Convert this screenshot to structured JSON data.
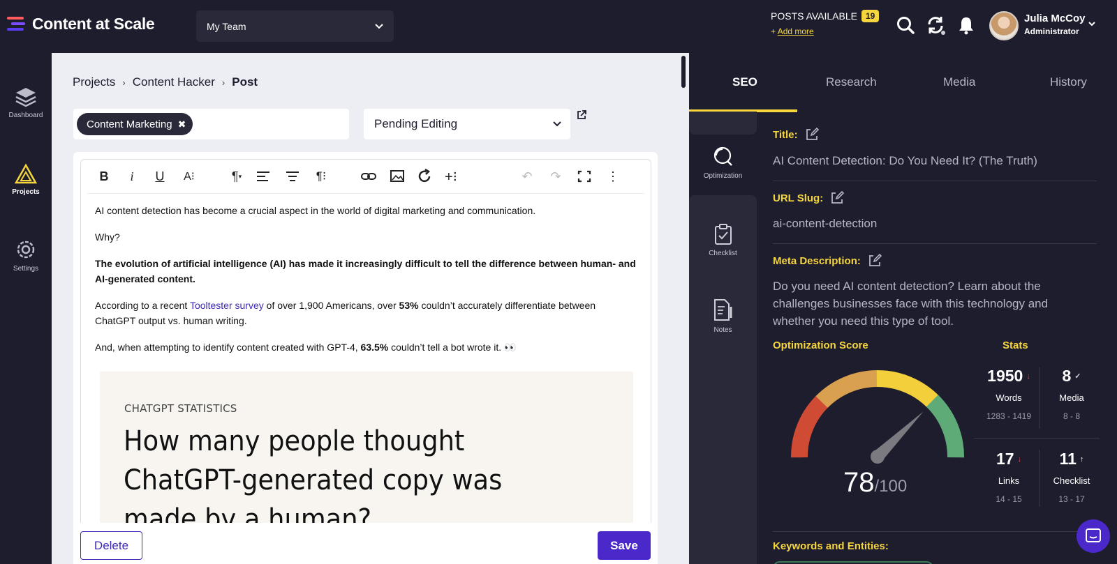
{
  "header": {
    "app_name": "Content at Scale",
    "team": "My Team",
    "posts_label": "POSTS AVAILABLE",
    "posts_count": "19",
    "add_more": "Add more",
    "user_name": "Julia McCoy",
    "user_role": "Administrator"
  },
  "sidebar": {
    "items": [
      {
        "label": "Dashboard",
        "icon": "layers-icon"
      },
      {
        "label": "Projects",
        "icon": "triangle-icon"
      },
      {
        "label": "Settings",
        "icon": "gear-icon"
      }
    ]
  },
  "breadcrumb": [
    "Projects",
    "Content Hacker",
    "Post"
  ],
  "tag": "Content Marketing",
  "status": "Pending Editing",
  "editor": {
    "p1": "AI content detection has become a crucial aspect in the world of digital marketing and communication.",
    "p2": "Why?",
    "p3": "The evolution of artificial intelligence (AI) has made it increasingly difficult to tell the difference between human- and AI-generated content.",
    "p4_a": "According to a recent ",
    "p4_link": "Tooltester survey",
    "p4_b": " of over 1,900 Americans, over ",
    "p4_bold": "53%",
    "p4_c": " couldn’t accurately differentiate between ChatGPT output vs. human writing.",
    "p5_a": "And, when attempting to identify content created with GPT-4, ",
    "p5_bold": "63.5%",
    "p5_c": " couldn’t tell a bot wrote it. 👀",
    "image_kicker": "CHATGPT STATISTICS",
    "image_headline": "How many people thought ChatGPT-generated copy was made by a human?"
  },
  "actions": {
    "delete": "Delete",
    "save": "Save"
  },
  "right_panel": {
    "tabs": [
      "SEO",
      "Research",
      "Media",
      "History"
    ],
    "rail": [
      "Optimization",
      "Checklist",
      "Notes"
    ],
    "title_label": "Title:",
    "title_value": "AI Content Detection: Do You Need It? (The Truth)",
    "slug_label": "URL Slug:",
    "slug_value": "ai-content-detection",
    "meta_label": "Meta Description:",
    "meta_value": "Do you need AI content detection? Learn about the challenges businesses face with this technology and whether you need this type of tool.",
    "opt_label": "Optimization Score",
    "stats_label": "Stats",
    "score": "78",
    "score_max": "/100",
    "score_value": 78,
    "keywords_label": "Keywords and Entities:",
    "stats": [
      {
        "value": "1950",
        "label": "Words",
        "range": "1283 - 1419",
        "arrow": "↓",
        "color": "#e8474b"
      },
      {
        "value": "8",
        "label": "Media",
        "range": "8 - 8",
        "arrow": "✓",
        "color": "#cfcfda"
      },
      {
        "value": "17",
        "label": "Links",
        "range": "14 - 15",
        "arrow": "↓",
        "color": "#e8474b"
      },
      {
        "value": "11",
        "label": "Checklist",
        "range": "13 - 17",
        "arrow": "↑",
        "color": "#ffffff"
      }
    ]
  },
  "colors": {
    "accent": "#f5d63d",
    "brand": "#4a28c9",
    "background": "#1e1d2e"
  }
}
